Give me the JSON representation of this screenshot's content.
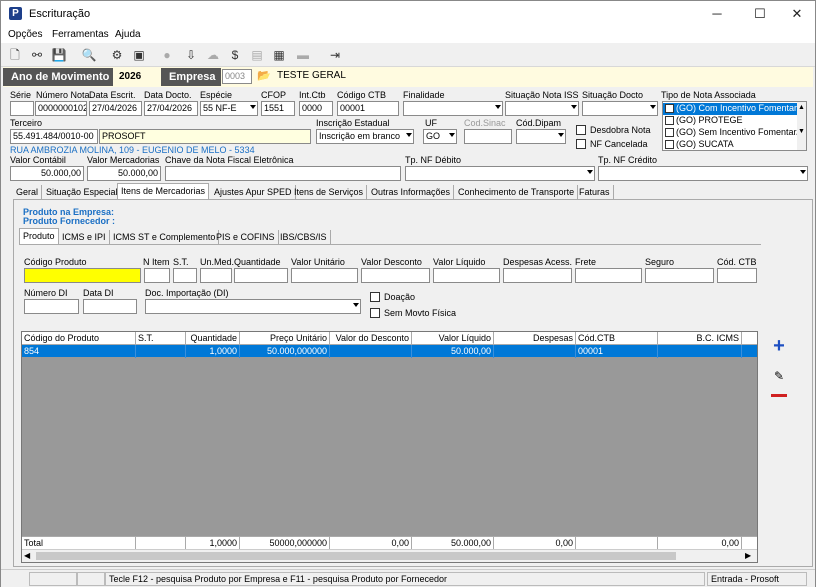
{
  "window": {
    "title": "Escrituração"
  },
  "menu": [
    "Opções",
    "Ferramentas",
    "Ajuda"
  ],
  "toolbar_icons": [
    "new-doc-icon",
    "link-icon",
    "save-icon",
    "print-preview-icon",
    "settings-icon",
    "stamp-icon",
    "apple-icon",
    "download-icon",
    "cloud-icon",
    "money-bag-icon",
    "table-icon",
    "calculator-icon",
    "minus-icon",
    "exit-icon"
  ],
  "header": {
    "ano_label": "Ano de Movimento",
    "ano_value": "2026",
    "empresa_label": "Empresa",
    "empresa_code": "0003",
    "empresa_name": "TESTE GERAL"
  },
  "fields": {
    "serie_label": "Série",
    "serie": "",
    "numero_label": "Número Nota",
    "numero": "0000000102",
    "data_escrit_label": "Data Escrit.",
    "data_escrit": "27/04/2026",
    "data_docto_label": "Data Docto.",
    "data_docto": "27/04/2026",
    "especie_label": "Espécie",
    "especie": "55   NF-E",
    "cfop_label": "CFOP",
    "cfop": "1551",
    "intctb_label": "Int.Ctb",
    "intctb": "0000",
    "codctb_label": "Código CTB",
    "codctb": "00001",
    "finalidade_label": "Finalidade",
    "finalidade": "",
    "sit_iss_label": "Situação Nota ISS",
    "sit_iss": "",
    "sit_docto_label": "Situação Docto",
    "sit_docto": "",
    "tipo_nota_label": "Tipo de Nota Associada",
    "terceiro_label": "Terceiro",
    "terceiro_cnpj": "55.491.484/0010-00",
    "terceiro_name": "PROSOFT",
    "insc_label": "Inscrição Estadual",
    "insc": "Inscrição em branco",
    "uf_label": "UF",
    "uf": "GO",
    "codsinac_label": "Cod.Sinac",
    "coddipam_label": "Cód.Dipam",
    "desdobra_label": "Desdobra Nota",
    "nfcancelada_label": "NF Cancelada",
    "address": "RUA AMBROZIA MOLINA, 109 - EUGENIO DE MELO - 5334",
    "valor_contabil_label": "Valor Contábil",
    "valor_contabil": "50.000,00",
    "valor_merc_label": "Valor Mercadorias",
    "valor_merc": "50.000,00",
    "chave_label": "Chave da Nota Fiscal Eletrônica",
    "tp_debito_label": "Tp. NF Débito",
    "tp_credito_label": "Tp. NF Crédito"
  },
  "tipo_nota_options": [
    "(GO) Com Incentivo Fomentar",
    "(GO) PROTEGE",
    "(GO) Sem Incentivo Fomentar/",
    "(GO) SUCATA"
  ],
  "tabs": [
    "Geral",
    "Situação Especial",
    "Itens de Mercadorias",
    "Ajustes Apur SPED",
    "Itens de Serviços",
    "Outras Informações",
    "Conhecimento de Transporte",
    "Faturas"
  ],
  "produto": {
    "empresa_label": "Produto na Empresa:",
    "fornecedor_label": "Produto Fornecedor :"
  },
  "subtabs": [
    "Produto",
    "ICMS e IPI",
    "ICMS ST e Complemento",
    "PIS e COFINS",
    "IBS/CBS/IS"
  ],
  "item_form": {
    "codigo_produto": "Código Produto",
    "nitem": "N Item",
    "st": "S.T.",
    "unmed": "Un.Med.",
    "quantidade": "Quantidade",
    "valor_unitario": "Valor Unitário",
    "valor_desconto": "Valor Desconto",
    "valor_liquido": "Valor Líquido",
    "despesas": "Despesas Acess.",
    "frete": "Frete",
    "seguro": "Seguro",
    "codctb": "Cód. CTB",
    "numero_di": "Número DI",
    "data_di": "Data DI",
    "doc_importacao": "Doc. Importação (DI)",
    "doacao": "Doação",
    "sem_movto": "Sem Movto Física"
  },
  "grid": {
    "columns": [
      "Código do Produto",
      "S.T.",
      "Quantidade",
      "Preço Unitário",
      "Valor do Desconto",
      "Valor Líquido",
      "Despesas",
      "Cód.CTB",
      "B.C. ICMS"
    ],
    "rows": [
      [
        "854",
        "",
        "1,0000",
        "50.000,000000",
        "",
        "50.000,00",
        "",
        "00001",
        ""
      ]
    ],
    "total": [
      "Total",
      "",
      "1,0000",
      "50000,000000",
      "0,00",
      "50.000,00",
      "0,00",
      "",
      "0,00"
    ]
  },
  "status": {
    "hint": "Tecle F12 - pesquisa Produto por Empresa e F11 - pesquisa Produto por Fornecedor",
    "mode": "Entrada - Prosoft"
  }
}
